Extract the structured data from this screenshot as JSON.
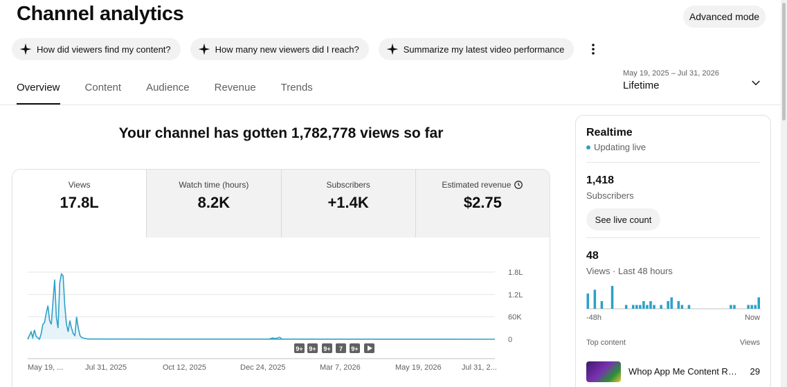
{
  "page": {
    "title": "Channel analytics",
    "advanced_mode": "Advanced mode"
  },
  "chips": [
    {
      "label": "How did viewers find my content?"
    },
    {
      "label": "How many new viewers did I reach?"
    },
    {
      "label": "Summarize my latest video performance"
    }
  ],
  "tabs": [
    {
      "label": "Overview",
      "active": true
    },
    {
      "label": "Content"
    },
    {
      "label": "Audience"
    },
    {
      "label": "Revenue"
    },
    {
      "label": "Trends"
    }
  ],
  "date_range": {
    "dates": "May 19, 2025 – Jul 31, 2026",
    "label": "Lifetime"
  },
  "headline": "Your channel has gotten 1,782,778 views so far",
  "metrics": [
    {
      "label": "Views",
      "value": "17.8L"
    },
    {
      "label": "Watch time (hours)",
      "value": "8.2K"
    },
    {
      "label": "Subscribers",
      "value": "+1.4K"
    },
    {
      "label": "Estimated revenue",
      "value": "$2.75",
      "icon": "clock-icon"
    }
  ],
  "chart_data": {
    "type": "line",
    "color": "#2ea0c7",
    "y_ticks": [
      "1.8L",
      "1.2L",
      "60K",
      "0"
    ],
    "x_ticks": [
      "May 19, ...",
      "Jul 31, 2025",
      "Oct 12, 2025",
      "Dec 24, 2025",
      "Mar 7, 2026",
      "May 19, 2026",
      "Jul 31, 2..."
    ],
    "markers": [
      "9+",
      "9+",
      "9+",
      "7",
      "9+"
    ],
    "series": [
      {
        "values": [
          0,
          10000,
          20000,
          5000,
          25000,
          8000,
          4000,
          0,
          15000,
          40000,
          45000,
          70000,
          90000,
          50000,
          40000,
          100000,
          160000,
          60000,
          30000,
          150000,
          175000,
          170000,
          90000,
          40000,
          20000,
          50000,
          30000,
          15000,
          10000,
          60000,
          30000,
          10000,
          5000,
          3000,
          2000,
          1000,
          500,
          500,
          500,
          500
        ]
      }
    ]
  },
  "realtime": {
    "title": "Realtime",
    "status": "Updating live",
    "subscribers_value": "1,418",
    "subscribers_label": "Subscribers",
    "live_count_button": "See live count",
    "views_value": "48",
    "views_label": "Views · Last 48 hours",
    "bars": [
      4,
      0,
      5,
      0,
      2,
      0,
      0,
      6,
      0,
      0,
      0,
      1,
      0,
      1,
      1,
      1,
      2,
      1,
      2,
      1,
      0,
      1,
      0,
      2,
      3,
      0,
      2,
      1,
      0,
      1,
      0,
      0,
      0,
      0,
      0,
      0,
      0,
      0,
      0,
      0,
      0,
      1,
      1,
      0,
      0,
      0,
      1,
      1,
      1,
      3
    ],
    "start_label": "-48h",
    "end_label": "Now",
    "top_content_label": "Top content",
    "views_header": "Views",
    "top_item": {
      "title": "Whop App Me Content Rewards",
      "views": "29"
    }
  }
}
